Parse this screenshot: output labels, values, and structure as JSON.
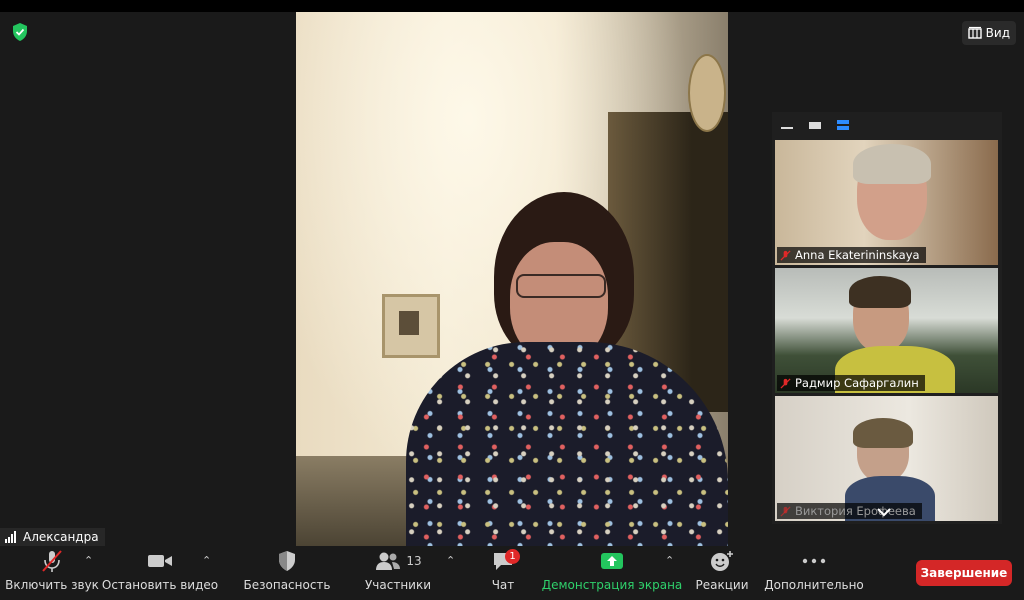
{
  "header": {
    "view_label": "Вид"
  },
  "self_view": {
    "name": "Александра"
  },
  "gallery": {
    "participants": [
      {
        "name": "Anna Ekaterininskaya",
        "muted": true
      },
      {
        "name": "Радмир Сафаргалин",
        "muted": true
      },
      {
        "name": "Виктория Ерофеева",
        "muted": true
      }
    ]
  },
  "toolbar": {
    "unmute_label": "Включить звук",
    "stop_video_label": "Остановить видео",
    "security_label": "Безопасность",
    "participants_label": "Участники",
    "participants_count": "13",
    "chat_label": "Чат",
    "chat_badge": "1",
    "share_label": "Демонстрация экрана",
    "reactions_label": "Реакции",
    "more_label": "Дополнительно",
    "end_label": "Завершение"
  },
  "colors": {
    "share_green": "#2fd06b",
    "end_red": "#d42727",
    "mute_red": "#e02828",
    "active_blue": "#2d8cff"
  }
}
